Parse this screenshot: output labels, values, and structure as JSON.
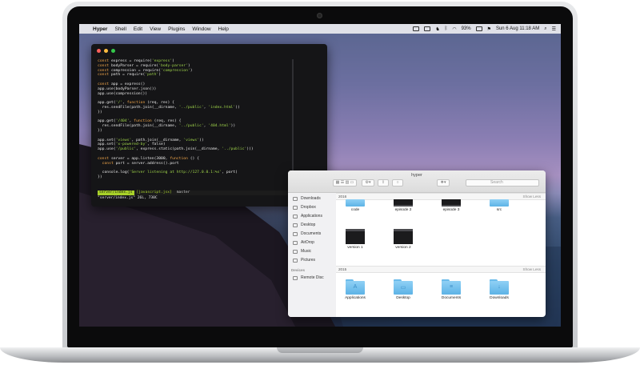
{
  "menubar": {
    "apple": "",
    "items": [
      "Hyper",
      "Shell",
      "Edit",
      "View",
      "Plugins",
      "Window",
      "Help"
    ],
    "status": {
      "battery": "93%",
      "datetime": "Sun 6 Aug 11:18 AM"
    }
  },
  "terminal": {
    "colors": {
      "background": "#151517",
      "keyword": "#f1a64a",
      "string": "#9fd44a",
      "statusbar": "#a8d12a"
    },
    "lines": [
      "const express = require('express')",
      "const bodyParser = require('body-parser')",
      "const compression = require('compression')",
      "const path = require('path')",
      "",
      "const app = express()",
      "app.use(bodyParser.json())",
      "app.use(compression())",
      "",
      "app.get('/', function (req, res) {",
      "  res.sendFile(path.join(__dirname, '../public', 'index.html'))",
      "})",
      "",
      "app.get('/404', function (req, res) {",
      "  res.sendFile(path.join(__dirname, '../public', '404.html'))",
      "})",
      "",
      "app.set('views', path.join(__dirname, 'views'))",
      "app.set('x-powered-by', false)",
      "app.use('/public', express.static(path.join(__dirname, '../public')))",
      "",
      "const server = app.listen(3000, function () {",
      "  const port = server.address().port",
      "",
      "  console.log('Server listening at http://127.0.0.1:%s', port)",
      "})"
    ],
    "statusbar": {
      "file": "server/index.js",
      "filetype": "[javascript.jsx]",
      "branch": "master",
      "position": "28/26[76%]"
    },
    "cmdline": "\"server/index.js\" 26L, 730C"
  },
  "finder": {
    "title": "hyper",
    "search_placeholder": "Search",
    "sidebar": [
      {
        "label": "Downloads",
        "icon": "downloads-icon"
      },
      {
        "label": "Dropbox",
        "icon": "dropbox-icon"
      },
      {
        "label": "Applications",
        "icon": "applications-icon"
      },
      {
        "label": "Desktop",
        "icon": "desktop-icon"
      },
      {
        "label": "Documents",
        "icon": "documents-icon"
      },
      {
        "label": "AirDrop",
        "icon": "airdrop-icon"
      },
      {
        "label": "Music",
        "icon": "music-icon"
      },
      {
        "label": "Pictures",
        "icon": "pictures-icon"
      }
    ],
    "devices_header": "Devices",
    "device": {
      "label": "Remote Disc",
      "icon": "remote-disc-icon"
    },
    "sections": [
      {
        "year": "2016",
        "show_less": "Show Less",
        "items": [
          {
            "label": "code",
            "kind": "folder"
          },
          {
            "label": "episode 2",
            "kind": "video"
          },
          {
            "label": "episode 3",
            "kind": "video"
          },
          {
            "label": "src",
            "kind": "folder"
          },
          {
            "label": "version 1",
            "kind": "video"
          },
          {
            "label": "version 2",
            "kind": "video"
          }
        ]
      },
      {
        "year": "2015",
        "show_less": "Show Less",
        "items": [
          {
            "label": "Applications",
            "kind": "folder",
            "glyph": "A"
          },
          {
            "label": "Desktop",
            "kind": "folder",
            "glyph": "▭"
          },
          {
            "label": "Documents",
            "kind": "folder",
            "glyph": "≡"
          },
          {
            "label": "Downloads",
            "kind": "folder",
            "glyph": "↓"
          }
        ]
      }
    ]
  }
}
